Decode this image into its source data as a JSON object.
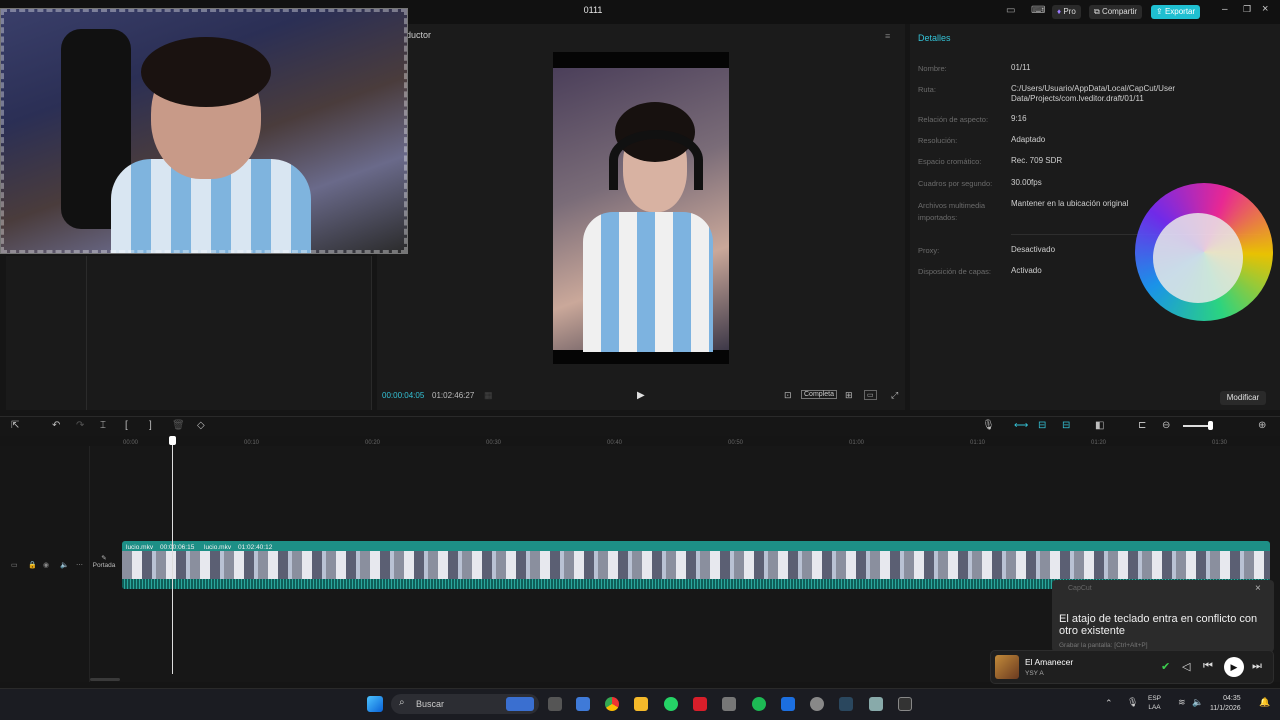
{
  "app": {
    "title": "0111",
    "buttons": {
      "pro": "Pro",
      "share": "Compartir",
      "export": "Exportar"
    }
  },
  "preview": {
    "tab_label": "ductor",
    "timecode_current": "00:00:04:05",
    "timecode_total": "01:02:46:27",
    "full_label": "Completa"
  },
  "details": {
    "title": "Detalles",
    "rows": [
      {
        "label": "Nombre:",
        "value": "01/11"
      },
      {
        "label": "Ruta:",
        "value": "C:/Users/Usuario/AppData/Local/CapCut/User Data/Projects/com.lveditor.draft/01/11"
      },
      {
        "label": "Relación de aspecto:",
        "value": "9:16"
      },
      {
        "label": "Resolución:",
        "value": "Adaptado"
      },
      {
        "label": "Espacio cromático:",
        "value": "Rec. 709 SDR"
      },
      {
        "label": "Cuadros por segundo:",
        "value": "30.00fps"
      },
      {
        "label": "Archivos multimedia importados:",
        "value": "Mantener en la ubicación original"
      },
      {
        "label": "Proxy:",
        "value": "Desactivado"
      },
      {
        "label": "Disposición de capas:",
        "value": "Activado"
      }
    ],
    "modify_button": "Modificar"
  },
  "timeline": {
    "ruler": [
      "00:00",
      "00:10",
      "00:20",
      "00:30",
      "00:40",
      "00:50",
      "01:00",
      "01:10",
      "01:20",
      "01:30"
    ],
    "clips": [
      {
        "name": "lucio.mkv",
        "duration": "00:00:06:15"
      },
      {
        "name": "lucio.mkv",
        "duration": "01:02:40:12"
      }
    ],
    "cover_label": "Portada"
  },
  "toast": {
    "app": "CapCut",
    "message": "El atajo de teclado entra en conflicto con otro existente",
    "sub": "Grabar la pantalla: [Ctrl+Alt+P]"
  },
  "media": {
    "song": "El Amanecer",
    "artist": "YSY A"
  },
  "taskbar": {
    "search": "Buscar",
    "lang1": "ESP",
    "lang2": "LAA",
    "time": "04:35",
    "date": "11/1/2026"
  }
}
